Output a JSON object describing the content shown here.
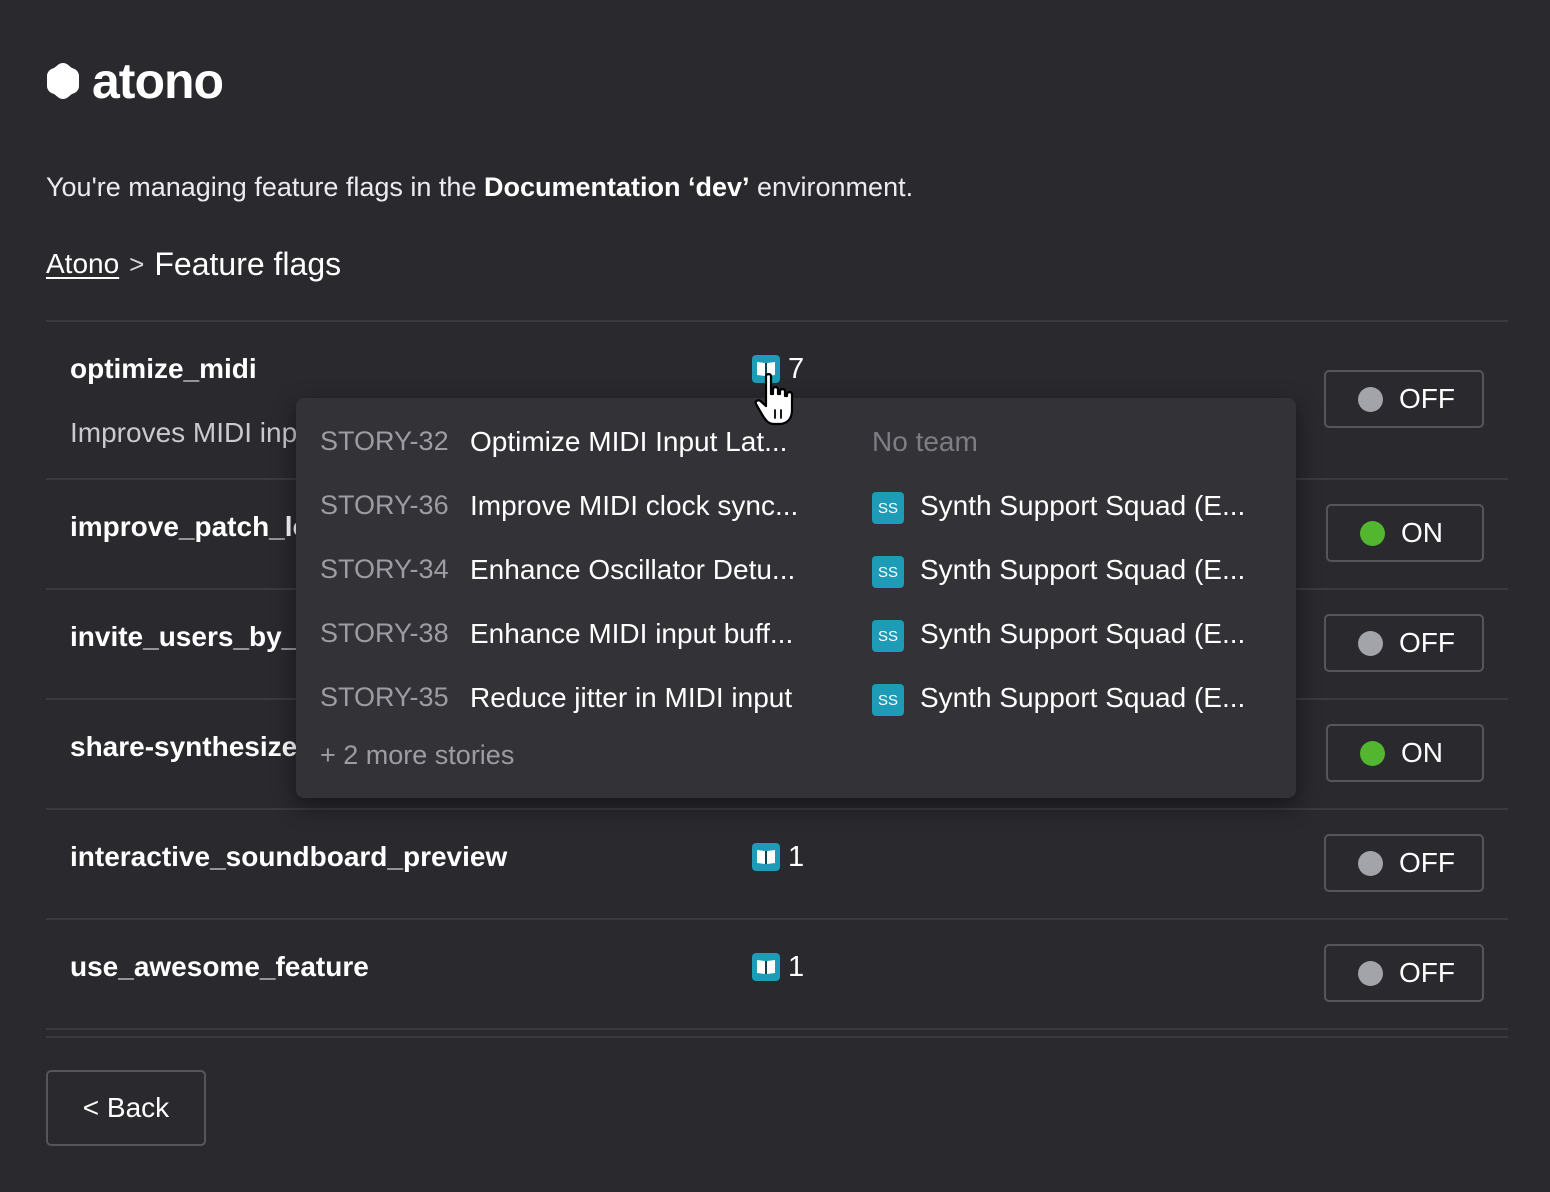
{
  "brand": {
    "name": "atono",
    "logo_icon": "atono-logo-icon"
  },
  "environment": {
    "prefix": "You're managing feature flags in the ",
    "name": "Documentation ‘dev’",
    "suffix": " environment."
  },
  "breadcrumb": {
    "root": "Atono",
    "separator": ">",
    "current": "Feature flags"
  },
  "flags": [
    {
      "name": "optimize_midi",
      "description": "Improves MIDI inp",
      "story_count": "7",
      "toggle": "OFF"
    },
    {
      "name": "improve_patch_lo",
      "story_count": "",
      "toggle": "ON"
    },
    {
      "name": "invite_users_by_e",
      "story_count": "",
      "toggle": "OFF"
    },
    {
      "name": "share-synthesize",
      "story_count": "",
      "toggle": "ON"
    },
    {
      "name": "interactive_soundboard_preview",
      "story_count": "1",
      "toggle": "OFF"
    },
    {
      "name": "use_awesome_feature",
      "story_count": "1",
      "toggle": "OFF"
    }
  ],
  "popover": {
    "stories": [
      {
        "id": "STORY-32",
        "title": "Optimize MIDI Input Lat...",
        "team_badge": "",
        "team": "No team"
      },
      {
        "id": "STORY-36",
        "title": "Improve MIDI clock sync...",
        "team_badge": "SS",
        "team": "Synth Support Squad (E..."
      },
      {
        "id": "STORY-34",
        "title": "Enhance Oscillator Detu...",
        "team_badge": "SS",
        "team": "Synth Support Squad (E..."
      },
      {
        "id": "STORY-38",
        "title": "Enhance MIDI input buff...",
        "team_badge": "SS",
        "team": "Synth Support Squad (E..."
      },
      {
        "id": "STORY-35",
        "title": "Reduce jitter in MIDI input",
        "team_badge": "SS",
        "team": "Synth Support Squad (E..."
      }
    ],
    "more": "+ 2 more stories"
  },
  "back_button": "< Back",
  "colors": {
    "background": "#29292e",
    "accent": "#1e9bb6",
    "on": "#52b62f",
    "off": "#a3a3aa"
  }
}
